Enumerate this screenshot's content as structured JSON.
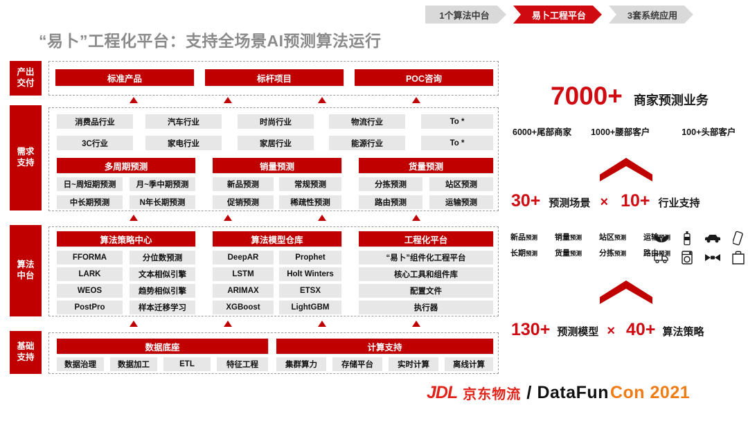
{
  "nav": {
    "items": [
      {
        "label": "1个算法中台",
        "active": false
      },
      {
        "label": "易卜工程平台",
        "active": true
      },
      {
        "label": "3套系统应用",
        "active": false
      }
    ]
  },
  "title": "“易卜”工程化平台：支持全场景AI预测算法运行",
  "rails": [
    {
      "label": "产出\n交付",
      "key": "output-delivery"
    },
    {
      "label": "需求\n支持",
      "key": "demand-support"
    },
    {
      "label": "算法\n中台",
      "key": "algorithm-platform"
    },
    {
      "label": "基础\n支持",
      "key": "foundation-support"
    }
  ],
  "output_row": {
    "bars": [
      "标准产品",
      "标杆项目",
      "POC咨询"
    ]
  },
  "industries": {
    "row1": [
      "消费品行业",
      "汽车行业",
      "时尚行业",
      "物流行业",
      "To *"
    ],
    "row2": [
      "3C行业",
      "家电行业",
      "家居行业",
      "能源行业",
      "To *"
    ]
  },
  "forecast_groups": [
    {
      "title": "多周期预测",
      "items": [
        "日~周短期预测",
        "月~季中期预测",
        "中长期预测",
        "N年长期预测"
      ]
    },
    {
      "title": "销量预测",
      "items": [
        "新品预测",
        "常规预测",
        "促销预测",
        "稀疏性预测"
      ]
    },
    {
      "title": "货量预测",
      "items": [
        "分拣预测",
        "站区预测",
        "路由预测",
        "运输预测"
      ]
    }
  ],
  "algo_groups": [
    {
      "title": "算法策略中心",
      "cols": 2,
      "items": [
        "FFORMA",
        "分位数预测",
        "LARK",
        "文本相似引擎",
        "WEOS",
        "趋势相似引擎",
        "PostPro",
        "样本迁移学习"
      ]
    },
    {
      "title": "算法模型仓库",
      "cols": 2,
      "items": [
        "DeepAR",
        "Prophet",
        "LSTM",
        "Holt Winters",
        "ARIMAX",
        "ETSX",
        "XGBoost",
        "LightGBM"
      ]
    },
    {
      "title": "工程化平台",
      "cols": 1,
      "items": [
        "“易卜”组件化工程平台",
        "核心工具和组件库",
        "配置文件",
        "执行器"
      ]
    }
  ],
  "base_groups": [
    {
      "title": "数据底座",
      "items": [
        "数据治理",
        "数据加工",
        "ETL",
        "特征工程"
      ]
    },
    {
      "title": "计算支持",
      "items": [
        "集群算力",
        "存储平台",
        "实时计算",
        "离线计算"
      ]
    }
  ],
  "right_panel": {
    "headline_number": "7000+",
    "headline_label": "商家预测业务",
    "breakdown": [
      "6000+尾部商家",
      "1000+腰部客户",
      "100+头部客户"
    ],
    "stat_scene": {
      "num1": "30+",
      "lbl1": "预测场景",
      "times": "×",
      "num2": "10+",
      "lbl2": "行业支持"
    },
    "scene_tags": [
      {
        "main": "新品",
        "mini": "预测"
      },
      {
        "main": "销量",
        "mini": "预测"
      },
      {
        "main": "站区",
        "mini": "预测"
      },
      {
        "main": "运输",
        "mini": "预测"
      },
      {
        "main": "长期",
        "mini": "预测"
      },
      {
        "main": "货量",
        "mini": "预测"
      },
      {
        "main": "分拣",
        "mini": "预测"
      },
      {
        "main": "路由",
        "mini": "预测"
      }
    ],
    "industry_icons": [
      "leaf-icon",
      "bottle-icon",
      "car-icon",
      "phone-icon",
      "truck-icon",
      "washer-icon",
      "bowtie-icon",
      "bag-icon"
    ],
    "stat_model": {
      "num1": "130+",
      "lbl1": "预测模型",
      "times": "×",
      "num2": "40+",
      "lbl2": "算法策略"
    }
  },
  "footer": {
    "jdl": "JDL",
    "jdl_cn": "京东物流",
    "slash": "/",
    "dfc_dark": "DataFun",
    "dfc_orange": "Con 2021"
  },
  "colors": {
    "brand_red": "#c00000",
    "accent_red": "#cf0a11",
    "chip_gray": "#e7e7e7",
    "nav_gray": "#d9d9d9",
    "title_gray": "#8a8a8a",
    "orange": "#f07c16"
  }
}
